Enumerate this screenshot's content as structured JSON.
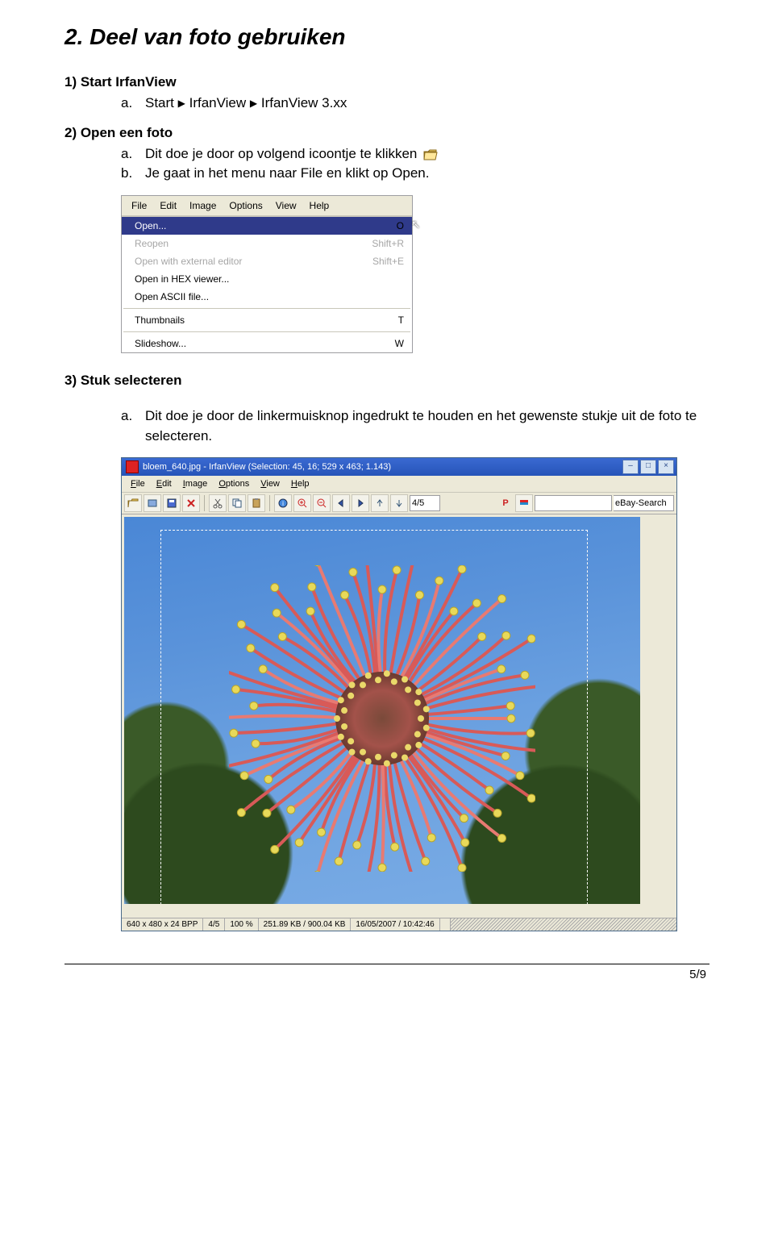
{
  "section_title": "2. Deel van foto gebruiken",
  "step1": {
    "heading": "1)  Start IrfanView",
    "a_label": "a.",
    "a_text": "Start",
    "a_seq1": "IrfanView",
    "a_seq2": "IrfanView 3.xx"
  },
  "step2": {
    "heading": "2)  Open een foto",
    "a_label": "a.",
    "a_text": "Dit doe je door op volgend icoontje te klikken",
    "b_label": "b.",
    "b_text": "Je gaat in het menu naar File en klikt op Open."
  },
  "menu": {
    "bar": [
      "File",
      "Edit",
      "Image",
      "Options",
      "View",
      "Help"
    ],
    "items": [
      {
        "label": "Open...",
        "shortcut": "O",
        "selected": true
      },
      {
        "label": "Reopen",
        "shortcut": "Shift+R",
        "disabled": true
      },
      {
        "label": "Open with external editor",
        "shortcut": "Shift+E",
        "disabled": true
      },
      {
        "label": "Open in HEX viewer..."
      },
      {
        "label": "Open ASCII file..."
      },
      {
        "sep": true
      },
      {
        "label": "Thumbnails",
        "shortcut": "T"
      },
      {
        "sep": true
      },
      {
        "label": "Slideshow...",
        "shortcut": "W"
      }
    ]
  },
  "step3": {
    "heading": "3)  Stuk selecteren",
    "a_label": "a.",
    "a_text": "Dit doe je door de linkermuisknop ingedrukt te houden en het gewenste stukje uit de foto te selecteren."
  },
  "app": {
    "title": "bloem_640.jpg - IrfanView (Selection: 45, 16; 529 x 463; 1.143)",
    "menubar": [
      "File",
      "Edit",
      "Image",
      "Options",
      "View",
      "Help"
    ],
    "page_indicator": "4/5",
    "p_letter": "P",
    "ebay": "eBay-Search",
    "status": {
      "dims": "640 x 480 x 24 BPP",
      "page": "4/5",
      "zoom": "100 %",
      "size": "251.89 KB / 900.04 KB",
      "date": "16/05/2007 / 10:42:46"
    }
  },
  "footer": "5/9"
}
